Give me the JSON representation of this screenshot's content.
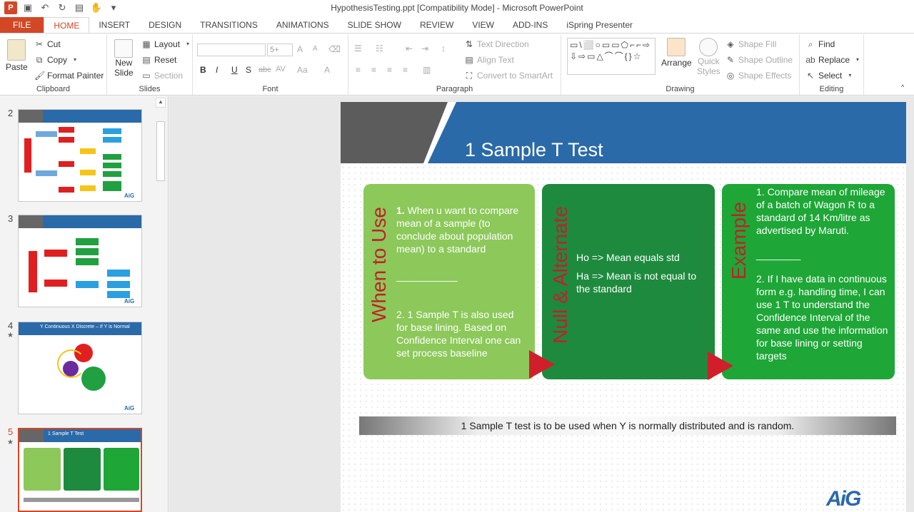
{
  "window": {
    "title": "HypothesisTesting.ppt [Compatibility Mode] - Microsoft PowerPoint"
  },
  "tabs": [
    "FILE",
    "HOME",
    "INSERT",
    "DESIGN",
    "TRANSITIONS",
    "ANIMATIONS",
    "SLIDE SHOW",
    "REVIEW",
    "VIEW",
    "ADD-INS",
    "iSpring Presenter"
  ],
  "active_tab": "HOME",
  "ribbon": {
    "clipboard": {
      "paste": "Paste",
      "cut": "Cut",
      "copy": "Copy",
      "format_painter": "Format Painter",
      "label": "Clipboard"
    },
    "slides": {
      "new_slide_1": "New",
      "new_slide_2": "Slide",
      "layout": "Layout",
      "reset": "Reset",
      "section": "Section",
      "label": "Slides"
    },
    "font": {
      "size": "5+",
      "bold": "B",
      "italic": "I",
      "underline": "U",
      "shadow": "S",
      "strike": "abc",
      "spacing": "AV",
      "case": "Aa",
      "color": "A",
      "grow": "A",
      "shrink": "A",
      "label": "Font"
    },
    "paragraph": {
      "text_direction": "Text Direction",
      "align_text": "Align Text",
      "convert_smartart": "Convert to SmartArt",
      "label": "Paragraph"
    },
    "drawing": {
      "shapes": "▭\\⬜○▭▭⬠⌐⌐⇨⇩⇨▭△⌒⌒{}☆",
      "arrange": "Arrange",
      "quick_styles_1": "Quick",
      "quick_styles_2": "Styles",
      "shape_fill": "Shape Fill",
      "shape_outline": "Shape Outline",
      "shape_effects": "Shape Effects",
      "label": "Drawing"
    },
    "editing": {
      "find": "Find",
      "replace": "Replace",
      "select": "Select",
      "label": "Editing"
    }
  },
  "thumbnails": [
    {
      "num": "2",
      "title": ""
    },
    {
      "num": "3",
      "title": ""
    },
    {
      "num": "4",
      "title": "Y Continuous X Discrete – If Y is Normal"
    },
    {
      "num": "5",
      "title": "1 Sample T Test"
    }
  ],
  "slide": {
    "title": "1 Sample T Test",
    "card1": {
      "heading": "When to Use",
      "p1_num": "1.",
      "p1": "When u want to compare mean of a sample (to conclude about population mean) to a standard",
      "sep": "___________",
      "p2": "2. 1 Sample T is also used for base lining. Based on Confidence Interval one can set process baseline"
    },
    "card2": {
      "heading": "Null & Alternate",
      "ho": "Ho => Mean equals std",
      "ha": "Ha => Mean is not equal to the standard"
    },
    "card3": {
      "heading": "Example",
      "p1": "1. Compare mean of mileage of a batch of Wagon R to a standard of 14 Km/litre as advertised by Maruti.",
      "sep": "________",
      "p2": "2. If I have data in continuous form e.g. handling time, I can use 1 T to understand the Confidence Interval of the same and use the information for base lining or setting targets"
    },
    "banner": "1 Sample T test is to be used when Y is normally distributed and is random.",
    "logo": "AiG"
  },
  "colors": {
    "accent": "#d24726",
    "slide_blue": "#2a6aa8",
    "card_light": "#8cc85a",
    "card_dark": "#1e8a3e",
    "card_bright": "#1ea637",
    "heading_red": "#c0202a"
  }
}
